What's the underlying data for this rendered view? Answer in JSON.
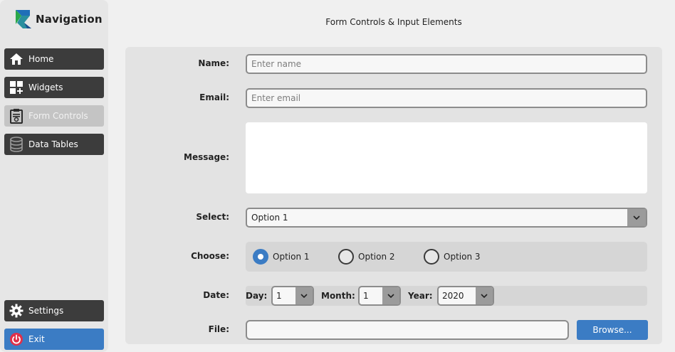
{
  "sidebar": {
    "title": "Navigation",
    "items": [
      {
        "label": "Home",
        "icon": "home-icon"
      },
      {
        "label": "Widgets",
        "icon": "widgets-icon"
      },
      {
        "label": "Form Controls",
        "icon": "clipboard-icon"
      },
      {
        "label": "Data Tables",
        "icon": "database-icon"
      }
    ],
    "settings_label": "Settings",
    "exit_label": "Exit"
  },
  "main": {
    "title": "Form Controls & Input Elements",
    "name": {
      "label": "Name:",
      "placeholder": "Enter name",
      "value": ""
    },
    "email": {
      "label": "Email:",
      "placeholder": "Enter email",
      "value": ""
    },
    "message": {
      "label": "Message:",
      "value": ""
    },
    "select": {
      "label": "Select:",
      "value": "Option 1"
    },
    "choose": {
      "label": "Choose:",
      "options": [
        "Option 1",
        "Option 2",
        "Option 3"
      ],
      "selected": "Option 1"
    },
    "date": {
      "label": "Date:",
      "day_label": "Day:",
      "day": "1",
      "month_label": "Month:",
      "month": "1",
      "year_label": "Year:",
      "year": "2020"
    },
    "file": {
      "label": "File:",
      "value": "",
      "browse_label": "Browse..."
    }
  },
  "colors": {
    "accent": "#3b7cc4",
    "sidebar_button": "#3c3c3c",
    "active_button": "#c4c4c4"
  }
}
